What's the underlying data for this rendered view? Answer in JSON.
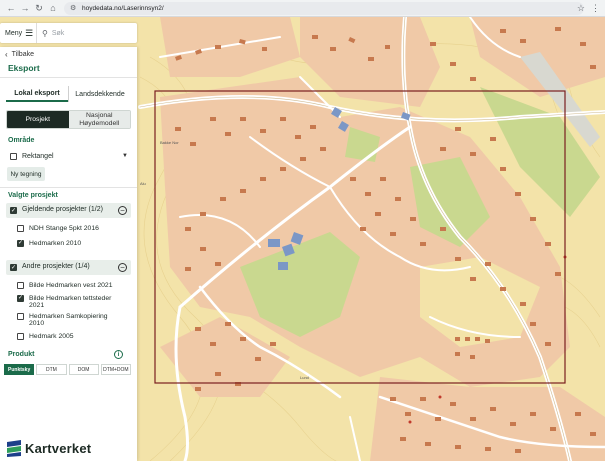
{
  "browser": {
    "url": "hoydedata.no/Laserinnsyn2/",
    "icons": [
      "back-arrow-icon",
      "forward-arrow-icon",
      "reload-icon",
      "home-icon",
      "site-info-icon",
      "bookmark-star-icon",
      "browser-menu-icon"
    ]
  },
  "toolbar": {
    "menu_label": "Meny",
    "search_placeholder": "Søk"
  },
  "panel": {
    "back_label": "Tilbake",
    "title": "Eksport",
    "tabs": [
      {
        "label": "Lokal eksport",
        "active": true
      },
      {
        "label": "Landsdekkende",
        "active": false
      }
    ],
    "segments": [
      {
        "label": "Prosjekt",
        "active": true
      },
      {
        "label": "Nasjonal Høydemodell",
        "active": false
      }
    ],
    "area": {
      "label": "Område",
      "select_value": "Rektangel",
      "new_drawing_button": "Ny tegning"
    },
    "projects": {
      "label": "Valgte prosjekt",
      "groups": [
        {
          "label": "Gjeldende prosjekter (1/2)",
          "checked": true,
          "items": [
            {
              "label": "NDH Stange 5pkt 2016",
              "checked": false
            },
            {
              "label": "Hedmarken 2010",
              "checked": true
            }
          ]
        },
        {
          "label": "Andre prosjekter (1/4)",
          "checked": true,
          "items": [
            {
              "label": "Bilde Hedmarken vest 2021",
              "checked": false
            },
            {
              "label": "Bilde Hedmarken tettsteder 2021",
              "checked": true
            },
            {
              "label": "Hedmarken Samkopiering 2010",
              "checked": false
            },
            {
              "label": "Hedmark 2005",
              "checked": false
            }
          ]
        }
      ]
    },
    "product": {
      "label": "Produkt",
      "options": [
        {
          "label": "Punktsky",
          "active": true
        },
        {
          "label": "DTM",
          "active": false
        },
        {
          "label": "DOM",
          "active": false
        },
        {
          "label": "DTM+DOM",
          "active": false
        }
      ]
    },
    "logo_text": "Kartverket"
  },
  "map": {
    "labels": [
      "Bakke Nor",
      "Alu",
      "Lund"
    ],
    "selection_rectangle_color": "#7a1f1f",
    "colors": {
      "land": "#f3e3a9",
      "built": "#f0c9a7",
      "forest": "#c9d88f",
      "building": "#c7794e",
      "road": "#ffffff",
      "highlight_building": "#7b97c6"
    }
  },
  "colors": {
    "accent": "#1b6b4a",
    "active_dark": "#1d2a24"
  }
}
